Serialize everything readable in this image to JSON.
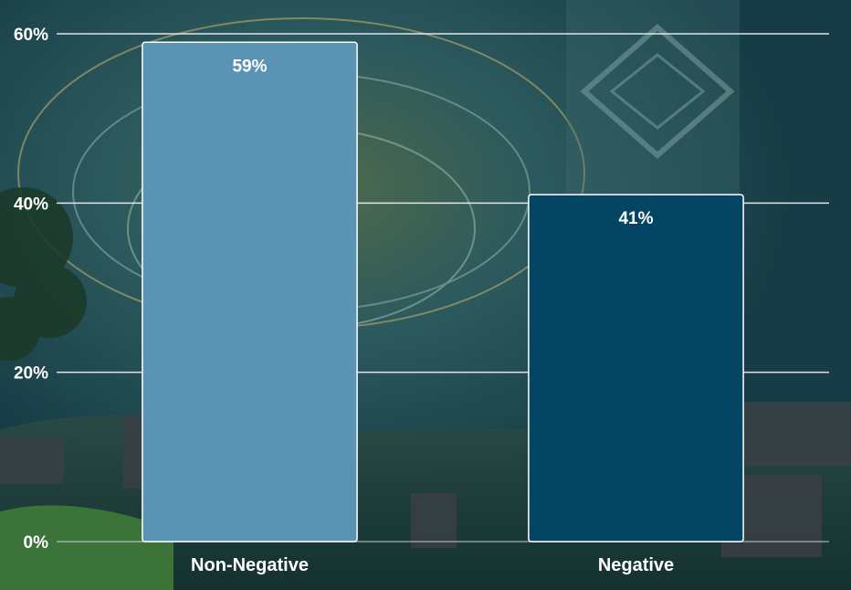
{
  "chart_data": {
    "type": "bar",
    "title": "",
    "xlabel": "",
    "ylabel": "",
    "categories": [
      "Non-Negative",
      "Negative"
    ],
    "values": [
      59,
      41
    ],
    "value_labels": [
      "59%",
      "41%"
    ],
    "bar_colors": [
      "#5b93b4",
      "#034563"
    ],
    "ylim": [
      0,
      60
    ],
    "yticks": [
      0,
      20,
      40,
      60
    ],
    "ytick_labels": [
      "0%",
      "20%",
      "40%",
      "60%"
    ],
    "grid": true,
    "legend": "none"
  },
  "colors": {
    "gridline": "#e8eef0",
    "bar_outline": "#ffffff",
    "text": "#ffffff"
  },
  "background": {
    "description_icon": "fantasy-game-scene"
  }
}
